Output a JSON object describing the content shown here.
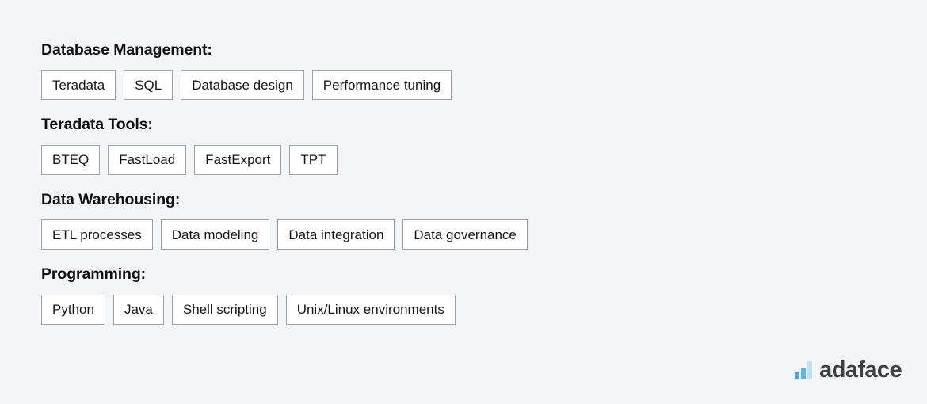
{
  "background_color": "#f4f5f7",
  "sections": [
    {
      "heading": "Database Management:",
      "tags": [
        "Teradata",
        "SQL",
        "Database design",
        "Performance tuning"
      ]
    },
    {
      "heading": "Teradata Tools:",
      "tags": [
        "BTEQ",
        "FastLoad",
        "FastExport",
        "TPT"
      ]
    },
    {
      "heading": "Data Warehousing:",
      "tags": [
        "ETL processes",
        "Data modeling",
        "Data integration",
        "Data governance"
      ]
    },
    {
      "heading": "Programming:",
      "tags": [
        "Python",
        "Java",
        "Shell scripting",
        "Unix/Linux environments"
      ]
    }
  ],
  "logo": {
    "text": "adaface",
    "icon": "bar-chart-logo-icon",
    "text_color": "#3f3f46",
    "bar_colors": [
      "#4aa3e0",
      "#5ab4ef",
      "#bfe1f7"
    ]
  }
}
